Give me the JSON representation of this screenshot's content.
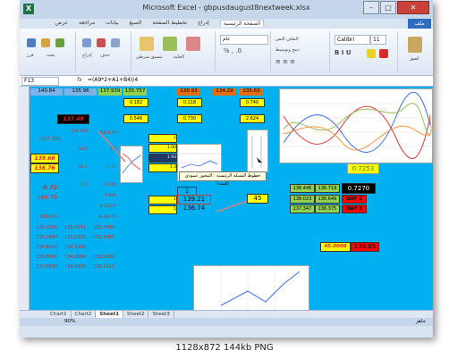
{
  "window": {
    "title": "Microsoft Excel - gbpusdaugust8nextweek.xlsx",
    "min": "–",
    "max": "□",
    "close": "✕"
  },
  "ribbon": {
    "file_tab": "ملف",
    "tabs": [
      "عرض",
      "مراجعة",
      "بيانات",
      "الصيغ",
      "تخطيط الصفحة",
      "إدراج",
      "الصفحة الرئيسية"
    ],
    "active_tab": "الصفحة الرئيسية",
    "font_name": "Calibri",
    "font_size": "11",
    "labels": [
      "لصق",
      "تنسيق",
      "الخلية",
      "تنسيق شرطي",
      "عام",
      "التفاف النص",
      "دمج وتوسيط",
      "إدراج",
      "حذف",
      "فرز",
      "بحث"
    ]
  },
  "formula_bar": {
    "name_box": "F13",
    "fx": "fx",
    "formula": "=(A9*2+A1+B4)/4"
  },
  "sheet": {
    "top_row": [
      "140.84",
      "135.96",
      "137.939",
      "135.757",
      "136.93",
      "134.29",
      "135.63"
    ],
    "row2": [
      "0.182",
      "0.118",
      "0.740"
    ],
    "row3": [
      "0.546",
      "0.730",
      "2.624"
    ],
    "highlight": "137.48",
    "left_col": [
      "157.200",
      "139.66",
      "136.76",
      "0.72",
      "140.79",
      "136.04"
    ],
    "left_col2": [
      "136.099",
      "0.07",
      "44.5",
      "0.5"
    ],
    "mid_col": [
      "-8.63176",
      "0.4",
      "1.10",
      "1.032",
      "1.002",
      "0.12277",
      "-0.01415"
    ],
    "table_rows": [
      [
        "135.1265",
        "135.0251",
        "132.7985"
      ],
      [
        "135.1495",
        "135.0329",
        "132.3487"
      ],
      [
        "134.6020",
        "134.3166",
        ""
      ],
      [
        "136.5490",
        "134.2894",
        "136.5090"
      ],
      [
        "137.5890",
        "136.3825",
        "138.4111"
      ]
    ],
    "small_yellow": [
      "1",
      "1.00",
      "1.93",
      "1.3",
      "1",
      "1"
    ],
    "mid_values": [
      "1",
      "139.21",
      "136.74"
    ],
    "value_45": "45",
    "right_block": [
      [
        "138.023",
        "136.649",
        "DAY 2"
      ],
      [
        "137.347",
        "136.375",
        "DAY 3"
      ]
    ],
    "right_top": [
      "138.446",
      "136.719",
      "0.7270"
    ],
    "green_value": "0.7253",
    "bottom_pair": [
      "45.0000",
      "136.85"
    ],
    "tooltip": "خطوط الشبكة الرئيسية : المحور عمودي (قيمة)"
  },
  "sheet_tabs": [
    "Chart1",
    "Chart2",
    "Sheet1",
    "Sheet2",
    "Sheet3"
  ],
  "active_sheet": "Sheet1",
  "status": {
    "zoom": "90%",
    "ready": "جاهز"
  },
  "caption": "1128x872  144kb  PNG"
}
